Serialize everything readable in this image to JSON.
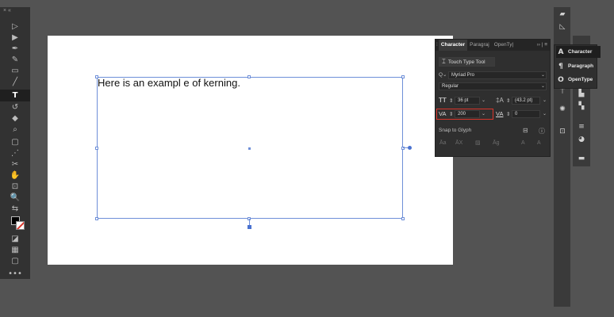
{
  "toolbar": {
    "collapse_label": "× «",
    "tools": [
      "▷",
      "▶",
      "✒",
      "✎",
      "▭",
      "╱",
      "T",
      "↺",
      "◆",
      "⌕",
      "▢",
      "⋰",
      "✂",
      "✋",
      "⊡",
      "🔍",
      "⇆",
      "◪",
      "▦",
      "▢",
      "⊞",
      "•••"
    ]
  },
  "canvas": {
    "text": "Here is an exampl e of kerning."
  },
  "character_panel": {
    "tabs": [
      "Character",
      "Paragraj",
      "OpenTy|"
    ],
    "menu_label": "›› | ≡",
    "touch_type_label": "Touch Type Tool",
    "font_family": "Myriad Pro",
    "font_style": "Regular",
    "font_size": "36 pt",
    "leading": "(43.2 pt)",
    "kerning": "200",
    "tracking": "0",
    "snap_label": "Snap to Glyph"
  },
  "dock_flyout": {
    "items": [
      {
        "icon": "A",
        "label": "Character"
      },
      {
        "icon": "¶",
        "label": "Paragraph"
      },
      {
        "icon": "O",
        "label": "OpenType"
      }
    ]
  },
  "colors": {
    "selection": "#6e8fd8",
    "kerning_highlight": "#d9352b",
    "panel_bg": "#2f2f2f"
  }
}
